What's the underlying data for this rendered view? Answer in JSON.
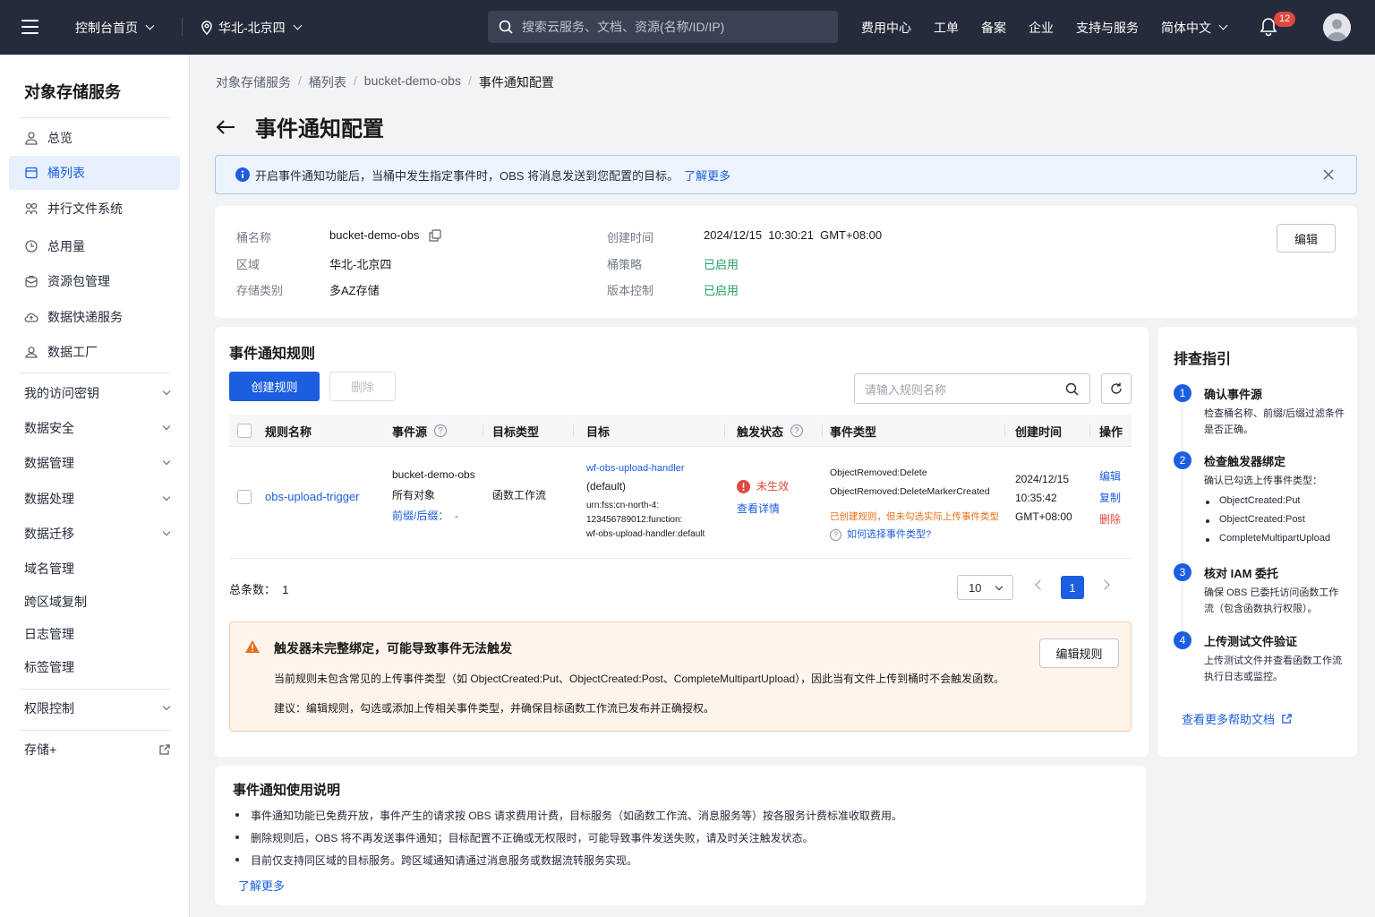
{
  "topbar": {
    "console_home": "控制台首页",
    "region": "华北-北京四",
    "search_placeholder": "搜索云服务、文档、资源(名称/ID/IP)",
    "links": [
      "费用中心",
      "工单",
      "备案",
      "企业",
      "支持与服务"
    ],
    "language": "简体中文",
    "notification_count": "12"
  },
  "sidebar": {
    "title": "对象存储服务",
    "items": [
      {
        "label": "总览",
        "icon": "user-icon"
      },
      {
        "label": "桶列表",
        "icon": "bucket-icon",
        "active": true
      },
      {
        "label": "并行文件系统",
        "icon": "parallel-fs-icon"
      },
      {
        "label": "总用量",
        "icon": "clock-icon"
      },
      {
        "label": "资源包管理",
        "icon": "package-icon"
      },
      {
        "label": "数据快递服务",
        "icon": "cloud-upload-icon"
      },
      {
        "label": "数据工厂",
        "icon": "factory-icon"
      }
    ],
    "groups": [
      "我的访问密钥",
      "数据安全",
      "数据管理",
      "数据处理",
      "数据迁移"
    ],
    "plain_items": [
      "域名管理",
      "跨区域复制",
      "日志管理",
      "标签管理"
    ],
    "permission": "权限控制",
    "storage_plus": "存储+"
  },
  "breadcrumb": [
    "对象存储服务",
    "桶列表",
    "bucket-demo-obs",
    "事件通知配置"
  ],
  "page_title": "事件通知配置",
  "info_bar": {
    "text": "开启事件通知功能后，当桶中发生指定事件时，OBS 将消息发送到您配置的目标。",
    "link": "了解更多"
  },
  "bucket_info": {
    "name_label": "桶名称",
    "name": "bucket-demo-obs",
    "region_label": "区域",
    "region": "华北-北京四",
    "storage_label": "存储类别",
    "storage": "多AZ存储",
    "created_label": "创建时间",
    "created": "2024/12/15  10:30:21  GMT+08:00",
    "policy_label": "桶策略",
    "policy": "已启用",
    "version_label": "版本控制",
    "version": "已启用",
    "edit_button": "编辑"
  },
  "rules": {
    "title": "事件通知规则",
    "create_button": "创建规则",
    "delete_button": "删除",
    "search_placeholder": "请输入规则名称",
    "columns": [
      "规则名称",
      "事件源",
      "目标类型",
      "目标",
      "触发状态",
      "事件类型",
      "创建时间",
      "操作"
    ],
    "row": {
      "name": "obs-upload-trigger",
      "source_bucket": "bucket-demo-obs",
      "source_objects": "所有对象",
      "source_prefix": "前缀/后缀：  -",
      "target_type": "函数工作流",
      "target_name": "wf-obs-upload-handler",
      "target_default": "(default)",
      "target_urn_1": "urn:fss:cn-north-4:",
      "target_urn_2": "123456789012:function:",
      "target_urn_3": "wf-obs-upload-handler:default",
      "status": "未生效",
      "status_link": "查看详情",
      "event_1": "ObjectRemoved:Delete",
      "event_2": "ObjectRemoved:DeleteMarkerCreated",
      "event_warning": "已创建规则，但未勾选实际上传事件类型",
      "event_help": "如何选择事件类型?",
      "created_date": "2024/12/15",
      "created_time": "10:35:42",
      "created_tz": "GMT+08:00",
      "actions": [
        "编辑",
        "复制",
        "删除"
      ]
    },
    "total": "总条数：  1",
    "page_size": "10",
    "current_page": "1"
  },
  "warning": {
    "title": "触发器未完整绑定，可能导致事件无法触发",
    "line1": "当前规则未包含常见的上传事件类型（如 ObjectCreated:Put、ObjectCreated:Post、CompleteMultipartUpload），因此当有文件上传到桶时不会触发函数。",
    "line2": "建议：编辑规则，勾选或添加上传相关事件类型，并确保目标函数工作流已发布并正确授权。",
    "button": "编辑规则"
  },
  "guide": {
    "title": "排查指引",
    "steps": [
      {
        "num": "1",
        "title": "确认事件源",
        "desc": "检查桶名称、前缀/后缀过滤条件是否正确。"
      },
      {
        "num": "2",
        "title": "检查触发器绑定",
        "desc": "确认已勾选上传事件类型：",
        "bullets": [
          "ObjectCreated:Put",
          "ObjectCreated:Post",
          "CompleteMultipartUpload"
        ]
      },
      {
        "num": "3",
        "title": "核对 IAM 委托",
        "desc": "确保 OBS 已委托访问函数工作流（包含函数执行权限）。"
      },
      {
        "num": "4",
        "title": "上传测试文件验证",
        "desc": "上传测试文件并查看函数工作流执行日志或监控。"
      }
    ],
    "more_link": "查看更多帮助文档"
  },
  "notes": {
    "title": "事件通知使用说明",
    "items": [
      "事件通知功能已免费开放，事件产生的请求按 OBS 请求费用计费，目标服务（如函数工作流、消息服务等）按各服务计费标准收取费用。",
      "删除规则后，OBS 将不再发送事件通知；目标配置不正确或无权限时，可能导致事件发送失败，请及时关注触发状态。",
      "目前仅支持同区域的目标服务。跨区域通知请通过消息服务或数据流转服务实现。"
    ],
    "link": "了解更多"
  },
  "colors": {
    "primary": "#1c5ee0",
    "topbar": "#252b3a",
    "success": "#20a162",
    "danger": "#e0493e",
    "warning": "#e36f1b"
  }
}
